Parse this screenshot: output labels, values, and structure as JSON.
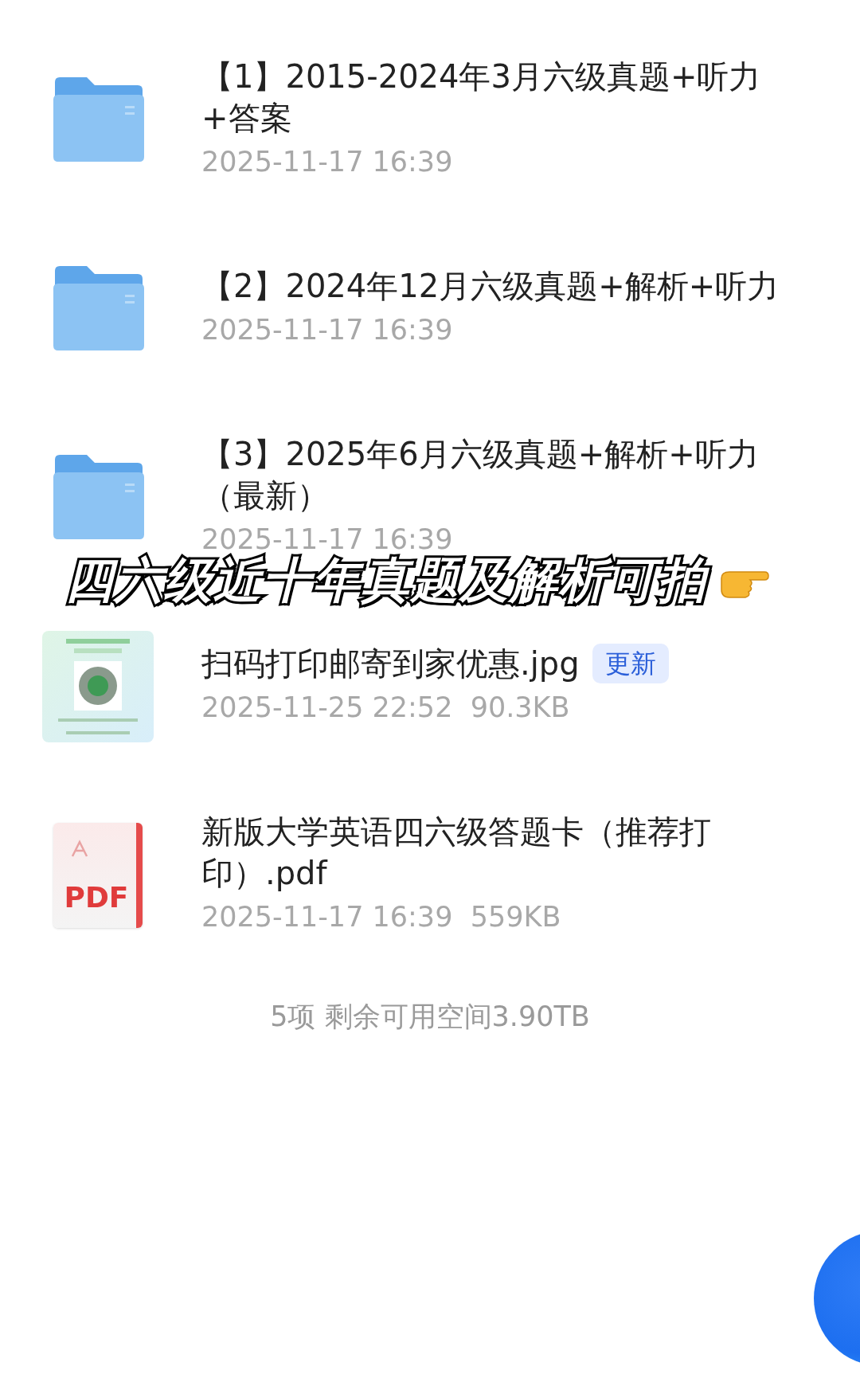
{
  "files": [
    {
      "kind": "folder",
      "name": "【1】2015-2024年3月六级真题+听力+答案",
      "date": "2025-11-17 16:39"
    },
    {
      "kind": "folder",
      "name": "【2】2024年12月六级真题+解析+听力",
      "date": "2025-11-17 16:39"
    },
    {
      "kind": "folder",
      "name": "【3】2025年6月六级真题+解析+听力（最新）",
      "date": "2025-11-17 16:39"
    },
    {
      "name": "扫码打印邮寄到家优惠.jpg",
      "badge": "更新",
      "date": "2025-11-25 22:52",
      "size": "90.3KB"
    },
    {
      "kind": "pdf",
      "icon_label": "PDF",
      "name": "新版大学英语四六级答题卡（推荐打印）.pdf",
      "date": "2025-11-17 16:39",
      "size": "559KB"
    }
  ],
  "footer": "5项 剩余可用空间3.90TB",
  "caption": "四六级近十年真题及解析可拍"
}
